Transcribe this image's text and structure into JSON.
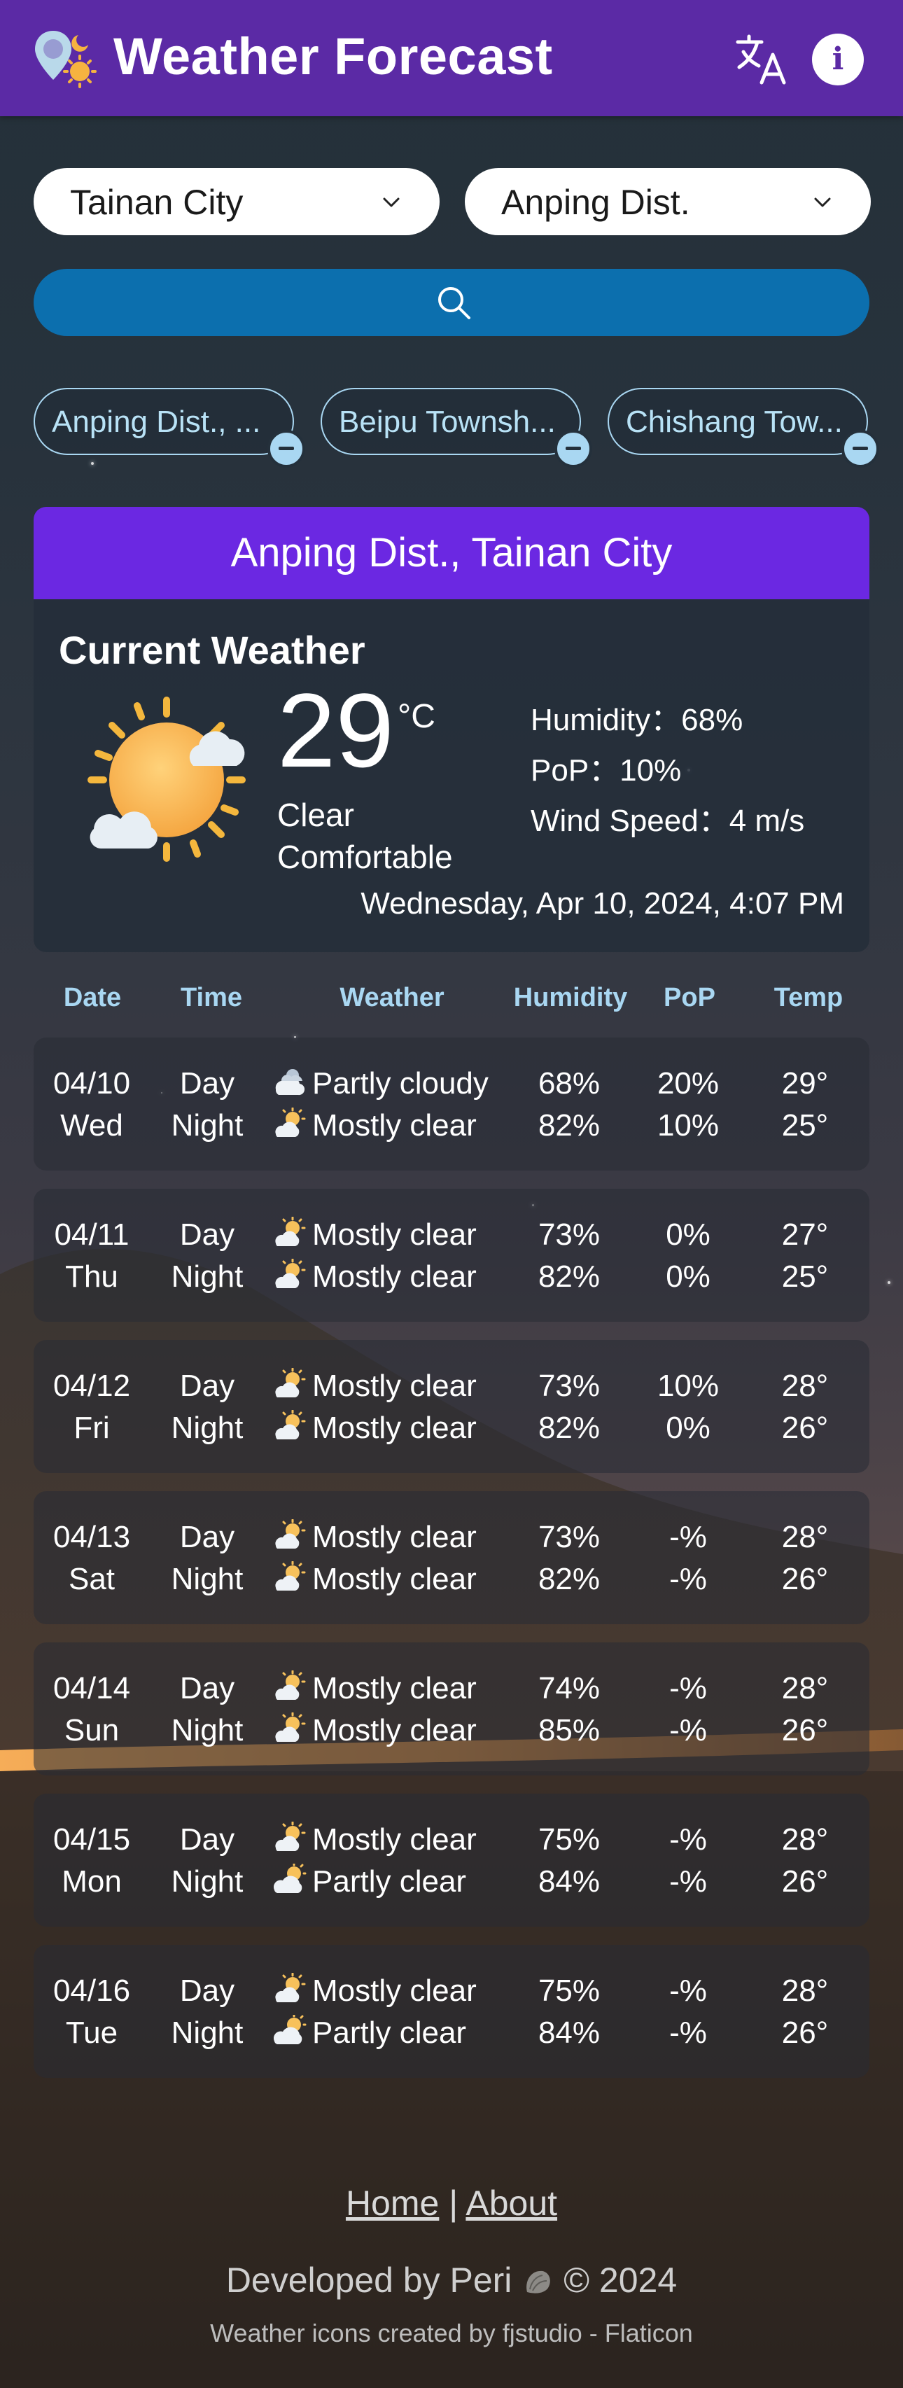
{
  "header": {
    "title": "Weather Forecast"
  },
  "selectors": {
    "city": "Tainan City",
    "district": "Anping Dist."
  },
  "saved_locations": [
    {
      "label": "Anping Dist., ..."
    },
    {
      "label": "Beipu Townsh..."
    },
    {
      "label": "Chishang Tow..."
    }
  ],
  "current": {
    "location": "Anping Dist., Tainan City",
    "heading": "Current Weather",
    "temperature": "29",
    "unit": "°C",
    "condition": "Clear",
    "comfort": "Comfortable",
    "humidity": "Humidity：68%",
    "pop": "PoP：10%",
    "wind": "Wind Speed：4 m/s",
    "datetime": "Wednesday, Apr 10, 2024, 4:07 PM"
  },
  "forecast": {
    "headers": {
      "date": "Date",
      "time": "Time",
      "weather": "Weather",
      "humidity": "Humidity",
      "pop": "PoP",
      "temp": "Temp"
    },
    "days": [
      {
        "date": "04/10",
        "weekday": "Wed",
        "day": {
          "time": "Day",
          "icon": "partly-cloudy-icon",
          "weather": "Partly cloudy",
          "humidity": "68%",
          "pop": "20%",
          "temp": "29°"
        },
        "night": {
          "time": "Night",
          "icon": "mostly-clear-icon",
          "weather": "Mostly clear",
          "humidity": "82%",
          "pop": "10%",
          "temp": "25°"
        }
      },
      {
        "date": "04/11",
        "weekday": "Thu",
        "day": {
          "time": "Day",
          "icon": "mostly-clear-icon",
          "weather": "Mostly clear",
          "humidity": "73%",
          "pop": "0%",
          "temp": "27°"
        },
        "night": {
          "time": "Night",
          "icon": "mostly-clear-icon",
          "weather": "Mostly clear",
          "humidity": "82%",
          "pop": "0%",
          "temp": "25°"
        }
      },
      {
        "date": "04/12",
        "weekday": "Fri",
        "day": {
          "time": "Day",
          "icon": "mostly-clear-icon",
          "weather": "Mostly clear",
          "humidity": "73%",
          "pop": "10%",
          "temp": "28°"
        },
        "night": {
          "time": "Night",
          "icon": "mostly-clear-icon",
          "weather": "Mostly clear",
          "humidity": "82%",
          "pop": "0%",
          "temp": "26°"
        }
      },
      {
        "date": "04/13",
        "weekday": "Sat",
        "day": {
          "time": "Day",
          "icon": "mostly-clear-icon",
          "weather": "Mostly clear",
          "humidity": "73%",
          "pop": "-%",
          "temp": "28°"
        },
        "night": {
          "time": "Night",
          "icon": "mostly-clear-icon",
          "weather": "Mostly clear",
          "humidity": "82%",
          "pop": "-%",
          "temp": "26°"
        }
      },
      {
        "date": "04/14",
        "weekday": "Sun",
        "day": {
          "time": "Day",
          "icon": "mostly-clear-icon",
          "weather": "Mostly clear",
          "humidity": "74%",
          "pop": "-%",
          "temp": "28°"
        },
        "night": {
          "time": "Night",
          "icon": "mostly-clear-icon",
          "weather": "Mostly clear",
          "humidity": "85%",
          "pop": "-%",
          "temp": "26°"
        }
      },
      {
        "date": "04/15",
        "weekday": "Mon",
        "day": {
          "time": "Day",
          "icon": "mostly-clear-icon",
          "weather": "Mostly clear",
          "humidity": "75%",
          "pop": "-%",
          "temp": "28°"
        },
        "night": {
          "time": "Night",
          "icon": "partly-clear-icon",
          "weather": "Partly clear",
          "humidity": "84%",
          "pop": "-%",
          "temp": "26°"
        }
      },
      {
        "date": "04/16",
        "weekday": "Tue",
        "day": {
          "time": "Day",
          "icon": "mostly-clear-icon",
          "weather": "Mostly clear",
          "humidity": "75%",
          "pop": "-%",
          "temp": "28°"
        },
        "night": {
          "time": "Night",
          "icon": "partly-clear-icon",
          "weather": "Partly clear",
          "humidity": "84%",
          "pop": "-%",
          "temp": "26°"
        }
      }
    ]
  },
  "footer": {
    "home": "Home",
    "separator": "|",
    "about": "About",
    "developed": "Developed by Peri",
    "copyright": "© 2024",
    "credit": "Weather icons created by fjstudio - Flaticon"
  },
  "colors": {
    "header": "#5b2aa5",
    "card_header": "#6b28e2",
    "search_button": "#0c6fae",
    "accent_text": "#a9d7f2"
  }
}
